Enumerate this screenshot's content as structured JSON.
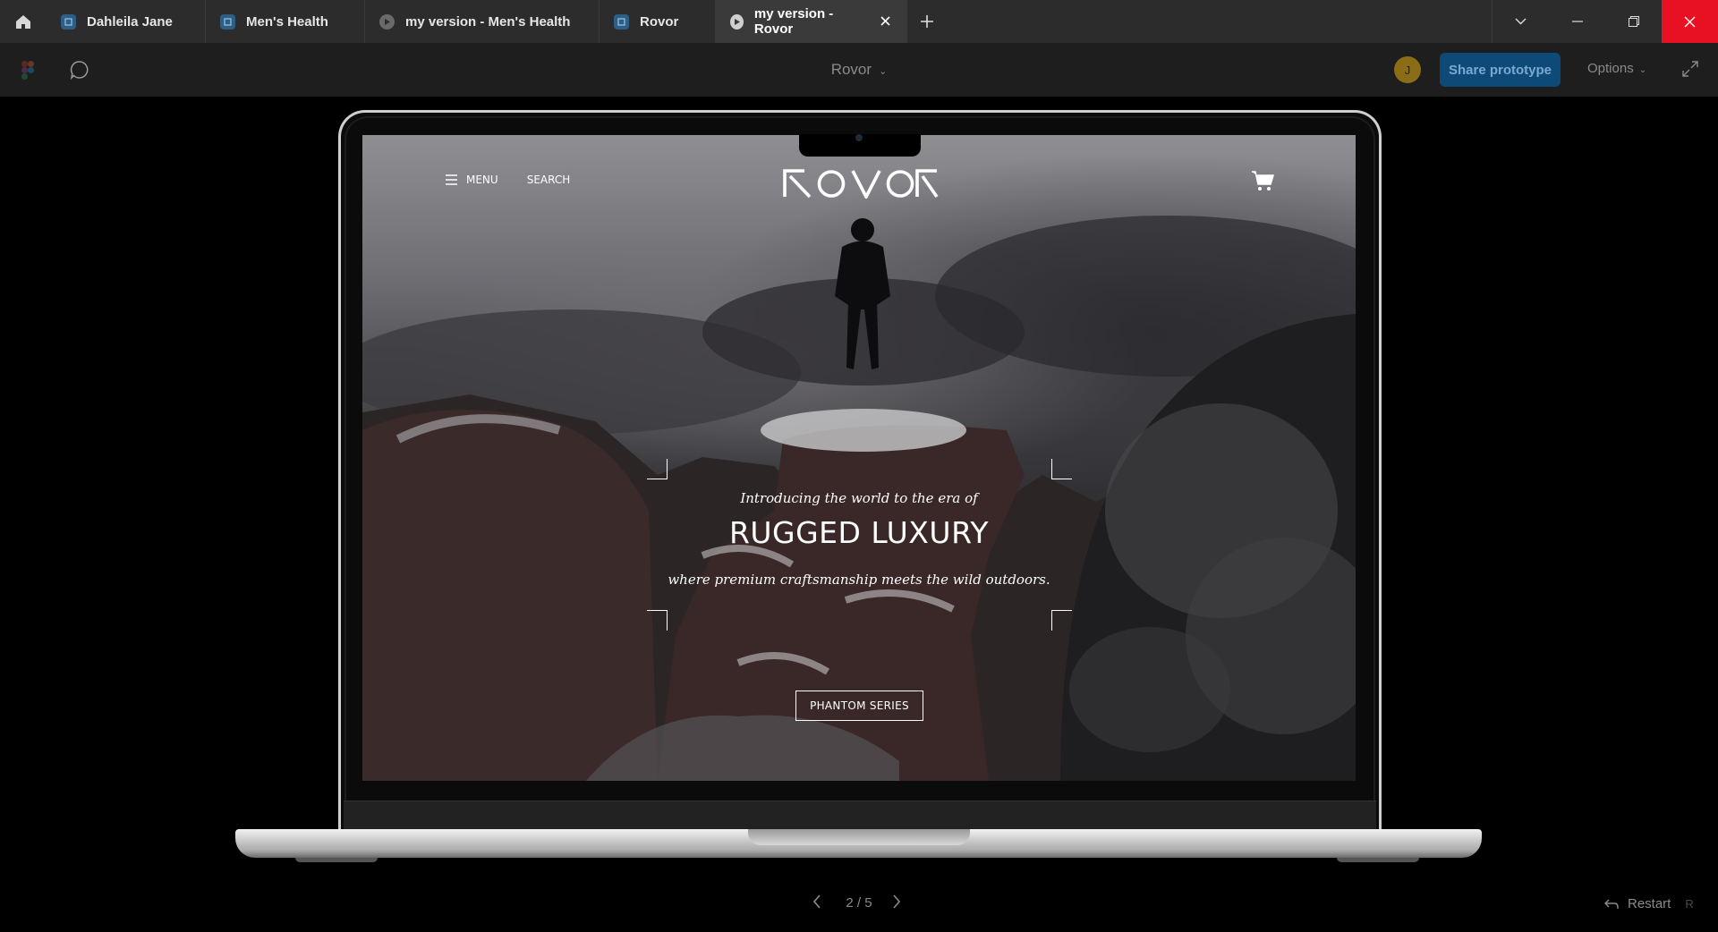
{
  "browser": {
    "tabs": [
      {
        "label": "Dahleila Jane",
        "type": "design"
      },
      {
        "label": "Men's Health",
        "type": "design"
      },
      {
        "label": "my version - Men's Health",
        "type": "prototype"
      },
      {
        "label": "Rovor",
        "type": "design"
      },
      {
        "label": "my version - Rovor",
        "type": "prototype",
        "active": true
      }
    ]
  },
  "toolbar": {
    "title": "Rovor",
    "avatar_initial": "J",
    "share_label": "Share prototype",
    "options_label": "Options"
  },
  "site": {
    "menu_label": "MENU",
    "search_label": "SEARCH",
    "brand": "ROVOR",
    "intro": "Introducing the world to the era of",
    "headline": "RUGGED LUXURY",
    "tagline": "where premium craftsmanship meets the wild outdoors.",
    "cta_label": "PHANTOM SERIES"
  },
  "pager": {
    "text": "2 / 5",
    "current": 2,
    "total": 5
  },
  "restart": {
    "label": "Restart",
    "shortcut": "R"
  },
  "colors": {
    "close_red": "#e81123",
    "share_blue": "#0e4a78",
    "avatar_gold": "#8a6d16"
  }
}
